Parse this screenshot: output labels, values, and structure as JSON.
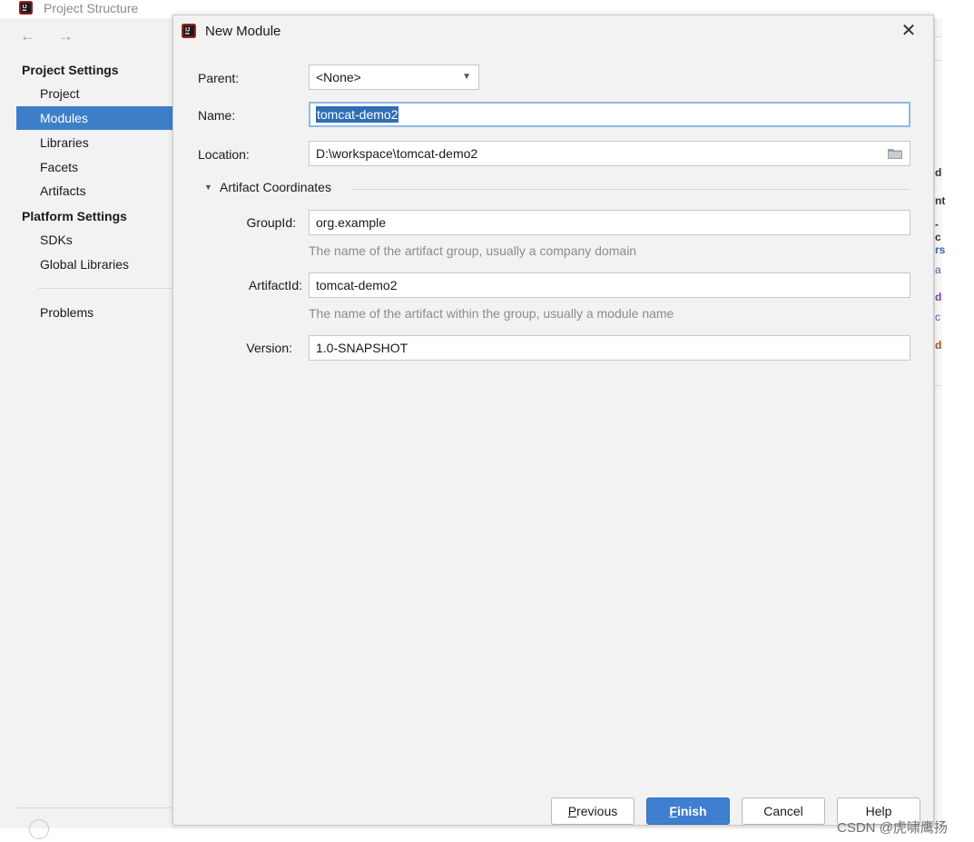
{
  "background_window": {
    "title": "Project Structure",
    "nav": "← →",
    "sidebar": {
      "project_settings_header": "Project Settings",
      "project_settings_items": [
        "Project",
        "Modules",
        "Libraries",
        "Facets",
        "Artifacts"
      ],
      "selected_item": "Modules",
      "platform_settings_header": "Platform Settings",
      "platform_settings_items": [
        "SDKs",
        "Global Libraries"
      ],
      "problems": "Problems"
    }
  },
  "dialog": {
    "title": "New Module",
    "close_glyph": "✕",
    "parent": {
      "label": "Parent:",
      "value": "<None>"
    },
    "name": {
      "label": "Name:",
      "value": "tomcat-demo2"
    },
    "location": {
      "label": "Location:",
      "value": "D:\\workspace\\tomcat-demo2"
    },
    "artifact_coordinates": {
      "title": "Artifact Coordinates",
      "groupid": {
        "label": "GroupId:",
        "value": "org.example",
        "hint": "The name of the artifact group, usually a company domain"
      },
      "artifactid": {
        "label": "ArtifactId:",
        "value": "tomcat-demo2",
        "hint": "The name of the artifact within the group, usually a module name"
      },
      "version": {
        "label": "Version:",
        "value": "1.0-SNAPSHOT"
      }
    },
    "buttons": {
      "previous": {
        "mnemonic": "P",
        "rest": "revious"
      },
      "finish": {
        "mnemonic": "F",
        "rest": "inish"
      },
      "cancel": "Cancel",
      "help": "Help"
    }
  },
  "right_edge_glyphs": [
    "d",
    "nt",
    "-c",
    "rs",
    "a",
    "d",
    "c",
    "d"
  ],
  "watermark": "CSDN @虎啸鹰扬",
  "colors": {
    "selection_blue": "#3d7fc9",
    "primary_button": "#3f7fd0",
    "hint_gray": "#8c8c8c"
  }
}
